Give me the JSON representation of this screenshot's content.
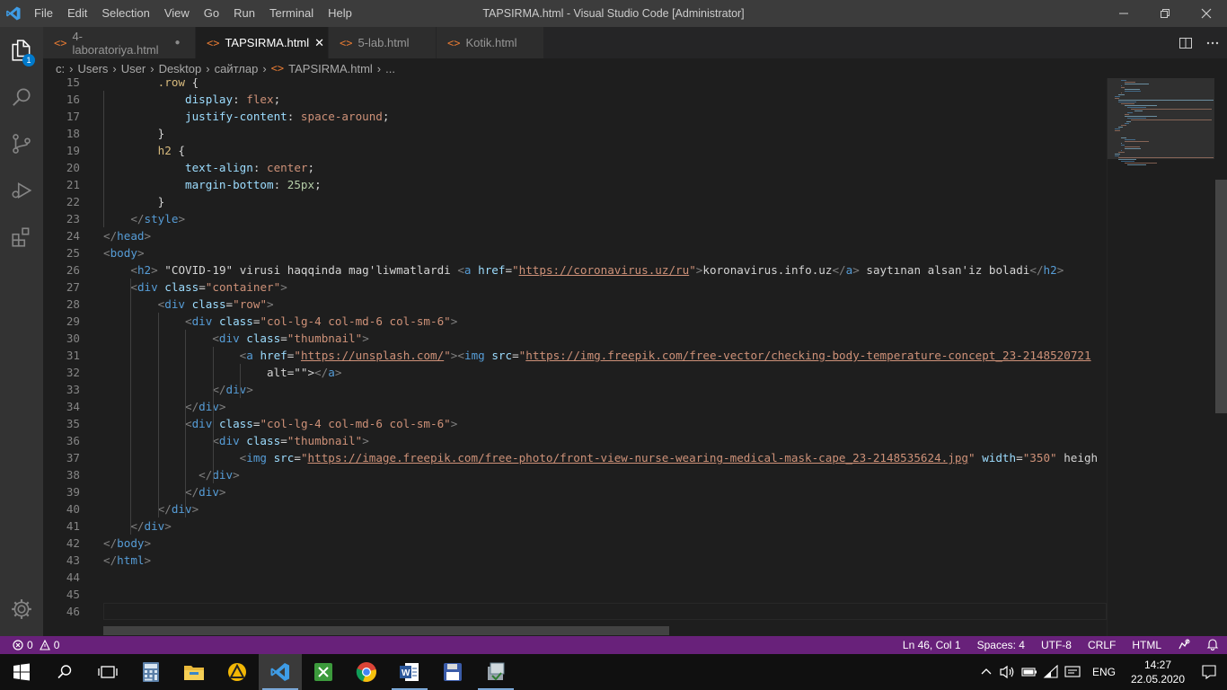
{
  "window": {
    "title": "TAPSIRMA.html - Visual Studio Code [Administrator]"
  },
  "menu": [
    "File",
    "Edit",
    "Selection",
    "View",
    "Go",
    "Run",
    "Terminal",
    "Help"
  ],
  "activity": {
    "explorer_badge": "1"
  },
  "tabs": [
    {
      "label": "4-laboratoriya.html",
      "state": "dirty"
    },
    {
      "label": "TAPSIRMA.html",
      "state": "active"
    },
    {
      "label": "5-lab.html",
      "state": "normal"
    },
    {
      "label": "Kotik.html",
      "state": "normal"
    }
  ],
  "breadcrumb": [
    "c:",
    "Users",
    "User",
    "Desktop",
    "сайтлар",
    "TAPSIRMA.html",
    "..."
  ],
  "editor": {
    "lines": [
      {
        "n": "15",
        "t": "        .row {"
      },
      {
        "n": "16",
        "t": "            display: flex;"
      },
      {
        "n": "17",
        "t": "            justify-content: space-around;"
      },
      {
        "n": "18",
        "t": "        }"
      },
      {
        "n": "19",
        "t": "        h2 {"
      },
      {
        "n": "20",
        "t": "            text-align: center;"
      },
      {
        "n": "21",
        "t": "            margin-bottom: 25px;"
      },
      {
        "n": "22",
        "t": "        }"
      },
      {
        "n": "23",
        "t": "    </style>"
      },
      {
        "n": "24",
        "t": "</head>"
      },
      {
        "n": "25",
        "t": "<body>"
      },
      {
        "n": "26",
        "t": "    <h2> \"COVID-19\" virusi haqqinda mag'liwmatlardi <a href=\"https://coronavirus.uz/ru\">koronavirus.info.uz</a> saytınan alsan'iz boladi</h2>"
      },
      {
        "n": "27",
        "t": "    <div class=\"container\">"
      },
      {
        "n": "28",
        "t": "        <div class=\"row\">"
      },
      {
        "n": "29",
        "t": "            <div class=\"col-lg-4 col-md-6 col-sm-6\">"
      },
      {
        "n": "30",
        "t": "                <div class=\"thumbnail\">"
      },
      {
        "n": "31",
        "t": "                    <a href=\"https://unsplash.com/\"><img src=\"https://img.freepik.com/free-vector/checking-body-temperature-concept_23-2148520721"
      },
      {
        "n": "32",
        "t": "                        alt=\"\"></a>"
      },
      {
        "n": "33",
        "t": "                </div>"
      },
      {
        "n": "34",
        "t": "            </div>"
      },
      {
        "n": "35",
        "t": "            <div class=\"col-lg-4 col-md-6 col-sm-6\">"
      },
      {
        "n": "36",
        "t": "                <div class=\"thumbnail\">"
      },
      {
        "n": "37",
        "t": "                    <img src=\"https://image.freepik.com/free-photo/front-view-nurse-wearing-medical-mask-cape_23-2148535624.jpg\" width=\"350\" heigh"
      },
      {
        "n": "38",
        "t": "              </div>"
      },
      {
        "n": "39",
        "t": "            </div>"
      },
      {
        "n": "40",
        "t": "        </div>"
      },
      {
        "n": "41",
        "t": "    </div>"
      },
      {
        "n": "42",
        "t": "</body>"
      },
      {
        "n": "43",
        "t": "</html>"
      },
      {
        "n": "44",
        "t": ""
      },
      {
        "n": "45",
        "t": ""
      },
      {
        "n": "46",
        "t": ""
      }
    ]
  },
  "statusbar": {
    "errors": "0",
    "warnings": "0",
    "position": "Ln 46, Col 1",
    "spaces": "Spaces: 4",
    "encoding": "UTF-8",
    "eol": "CRLF",
    "language": "HTML"
  },
  "taskbar": {
    "language": "ENG",
    "time": "14:27",
    "date": "22.05.2020"
  },
  "colors": {
    "statusbar": "#68217a",
    "titlebar": "#3c3c3c",
    "editor_bg": "#1e1e1e",
    "tab_icon": "#e37933"
  }
}
